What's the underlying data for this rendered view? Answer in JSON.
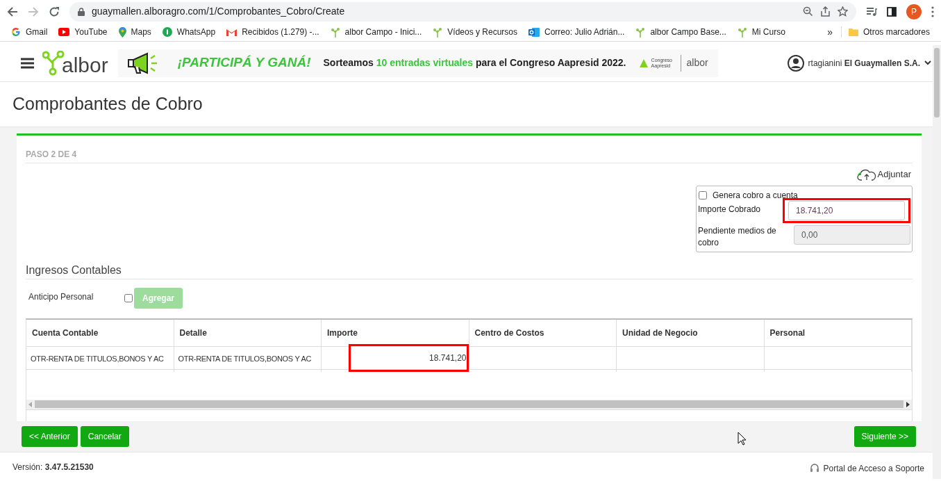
{
  "browser": {
    "url": "guaymallen.alboragro.com/1/Comprobantes_Cobro/Create",
    "profile_initial": "P",
    "bookmarks": [
      {
        "label": "Gmail",
        "kind": "g"
      },
      {
        "label": "YouTube",
        "kind": "play"
      },
      {
        "label": "Maps",
        "kind": "pin"
      },
      {
        "label": "WhatsApp",
        "kind": "chat"
      },
      {
        "label": "Recibidos (1.279) -...",
        "kind": "mail"
      },
      {
        "label": "albor Campo - Inici...",
        "kind": "sprout"
      },
      {
        "label": "Vídeos y Recursos",
        "kind": "sprout"
      },
      {
        "label": "Correo: Julio Adrián...",
        "kind": "outlook"
      },
      {
        "label": "albor Campo Base...",
        "kind": "sprout"
      },
      {
        "label": "Mi Curso",
        "kind": "sprout"
      }
    ],
    "more": "»",
    "other_bookmarks": "Otros marcadores"
  },
  "header": {
    "logo": "albor",
    "banner": {
      "headline": "¡PARTICIPÁ Y GANÁ!",
      "parts": [
        {
          "text": "Sorteamos ",
          "highlight": false
        },
        {
          "text": "10 entradas virtuales",
          "highlight": true
        },
        {
          "text": " para el Congreso Aapresid 2022.",
          "highlight": false
        }
      ],
      "sponsor": "Congreso Aapresid",
      "brand": "albor"
    },
    "user": "rtagianini",
    "company": "El Guaymallen S.A."
  },
  "page_title": "Comprobantes de Cobro",
  "step": "PASO 2 DE 4",
  "attach": "Adjuntar",
  "payment_box": {
    "on_account": {
      "label": "Genera cobro a cuenta",
      "checked": false
    },
    "fields": [
      {
        "label": "Importe Cobrado",
        "value": "18.741,20",
        "disabled": false,
        "highlighted": true
      },
      {
        "label": "Pendiente medios de cobro",
        "value": "0,00",
        "disabled": true,
        "highlighted": false
      }
    ]
  },
  "section_title": "Ingresos Contables",
  "advance": {
    "label": "Anticipo Personal",
    "checked": false,
    "button": "Agregar",
    "button_disabled": true
  },
  "table": {
    "columns": [
      "Cuenta Contable",
      "Detalle",
      "Importe",
      "Centro de Costos",
      "Unidad de Negocio",
      "Personal"
    ],
    "rows": [
      [
        {
          "text": "OTR-RENTA DE TITULOS,BONOS Y AC",
          "highlighted": false
        },
        {
          "text": "OTR-RENTA DE TITULOS,BONOS Y AC",
          "highlighted": false
        },
        {
          "text": "18.741,20",
          "highlighted": true
        },
        {
          "highlighted": false
        },
        {
          "highlighted": false
        },
        {
          "highlighted": false
        }
      ]
    ]
  },
  "buttons": {
    "back": "<< Anterior",
    "cancel": "Cancelar",
    "next": "Siguiente >>"
  },
  "footer": {
    "version_label": "Versión:",
    "version": "3.47.5.21530",
    "support": "Portal de Acceso a Soporte"
  }
}
